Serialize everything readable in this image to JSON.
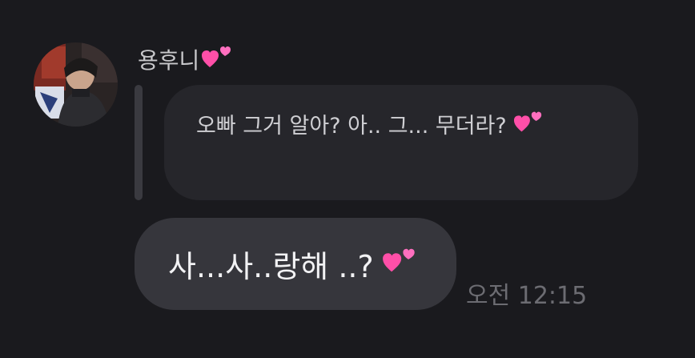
{
  "message": {
    "sender_name": "용후니",
    "sender_emoji": "two-hearts-icon",
    "reply_preview_text": "오빠 그거 알아? 아.. 그... 무더라?",
    "reply_preview_emoji": "two-hearts-icon",
    "body_text": "사...사..랑해 ..?",
    "body_emoji": "two-hearts-icon",
    "timestamp": "오전 12:15"
  },
  "colors": {
    "background": "#1a1a1e",
    "reply_bubble": "#26262b",
    "main_bubble": "#36363c",
    "heart": "#ff4fa8",
    "timestamp": "#6c6c72"
  }
}
